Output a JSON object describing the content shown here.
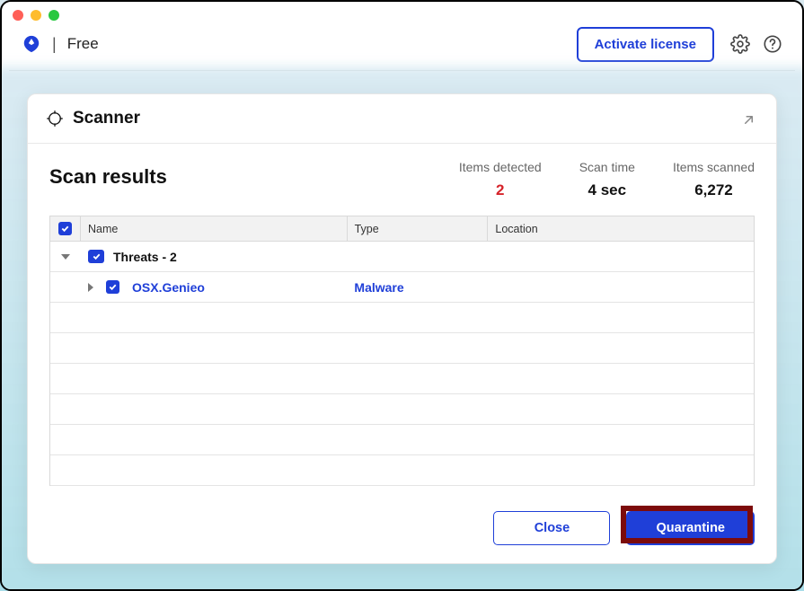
{
  "brand": {
    "tier": "Free",
    "divider": "|"
  },
  "header": {
    "activate_label": "Activate license",
    "settings_icon": "gear-icon",
    "help_icon": "help-icon"
  },
  "card": {
    "title": "Scanner",
    "collapse_icon": "collapse-icon"
  },
  "summary": {
    "title": "Scan results",
    "stats": [
      {
        "label": "Items detected",
        "value": "2",
        "red": true
      },
      {
        "label": "Scan time",
        "value": "4 sec"
      },
      {
        "label": "Items scanned",
        "value": "6,272"
      }
    ]
  },
  "table": {
    "columns": {
      "name": "Name",
      "type": "Type",
      "location": "Location"
    },
    "group_label": "Threats - 2",
    "rows": [
      {
        "name": "OSX.Genieo",
        "type": "Malware",
        "location": ""
      }
    ],
    "empty_rows": 6
  },
  "footer": {
    "close_label": "Close",
    "quarantine_label": "Quarantine"
  }
}
